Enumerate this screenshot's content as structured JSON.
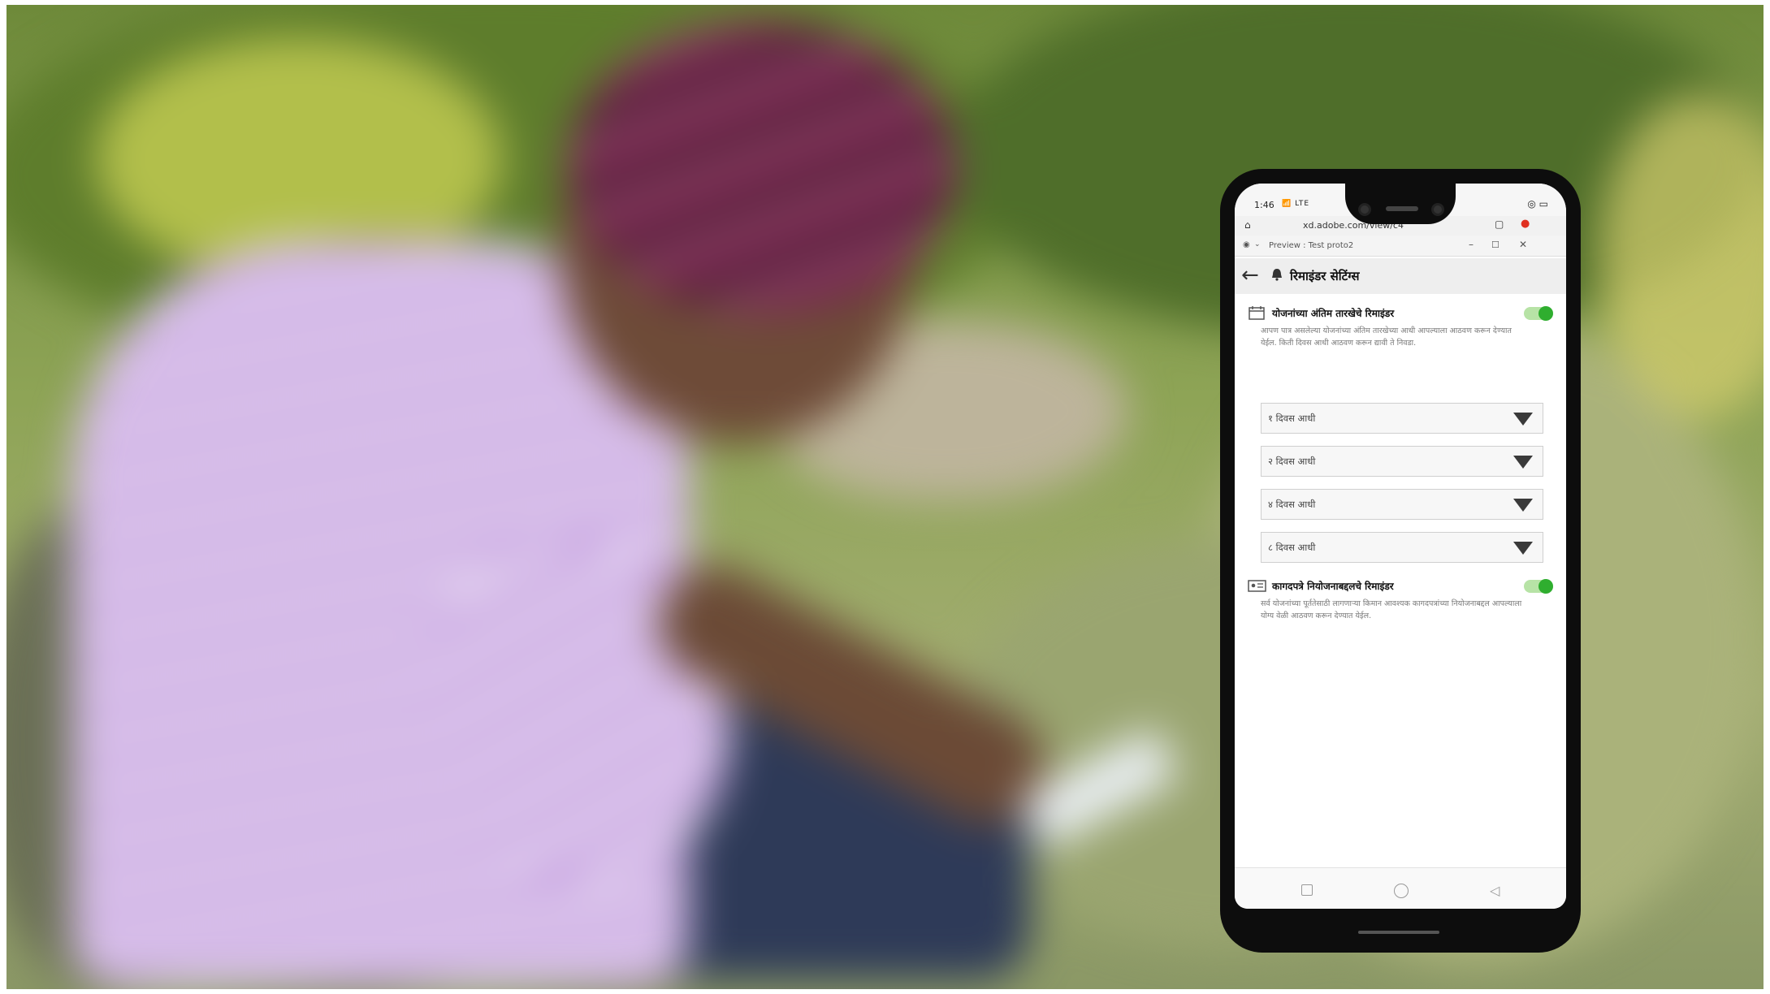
{
  "phone": {
    "status": {
      "time": "1:46",
      "network": "📶 LTE"
    },
    "browser": {
      "url": "xd.adobe.com/view/c4"
    },
    "window_title": "Preview : Test proto2",
    "app": {
      "title": "रिमाइंडर सेटिंग्स",
      "sections": [
        {
          "title": "योजनांच्या अंतिम तारखेचे रिमाइंडर",
          "enabled": true,
          "description": "आपण पात्र असलेल्या योजनांच्या अंतिम तारखेच्या आधी आपल्याला आठवण करून देण्यात येईल. किती दिवस आधी आठवण करून द्यावी ते निवडा.",
          "dropdowns": [
            "१ दिवस आधी",
            "२ दिवस आधी",
            "४ दिवस आधी",
            "८ दिवस आधी"
          ]
        },
        {
          "title": "कागदपत्रे नियोजनाबद्दलचे रिमाइंडर",
          "enabled": true,
          "description": "सर्व योजनांच्या पूर्ततेसाठी लागणाऱ्या किमान आवश्यक कागदपत्रांच्या नियोजनाबद्दल आपल्याला योग्य वेळी आठवण करून देण्यात येईल."
        }
      ]
    },
    "colors": {
      "toggle_on": "#2fae2f",
      "toggle_track": "#b7e3a6"
    }
  }
}
